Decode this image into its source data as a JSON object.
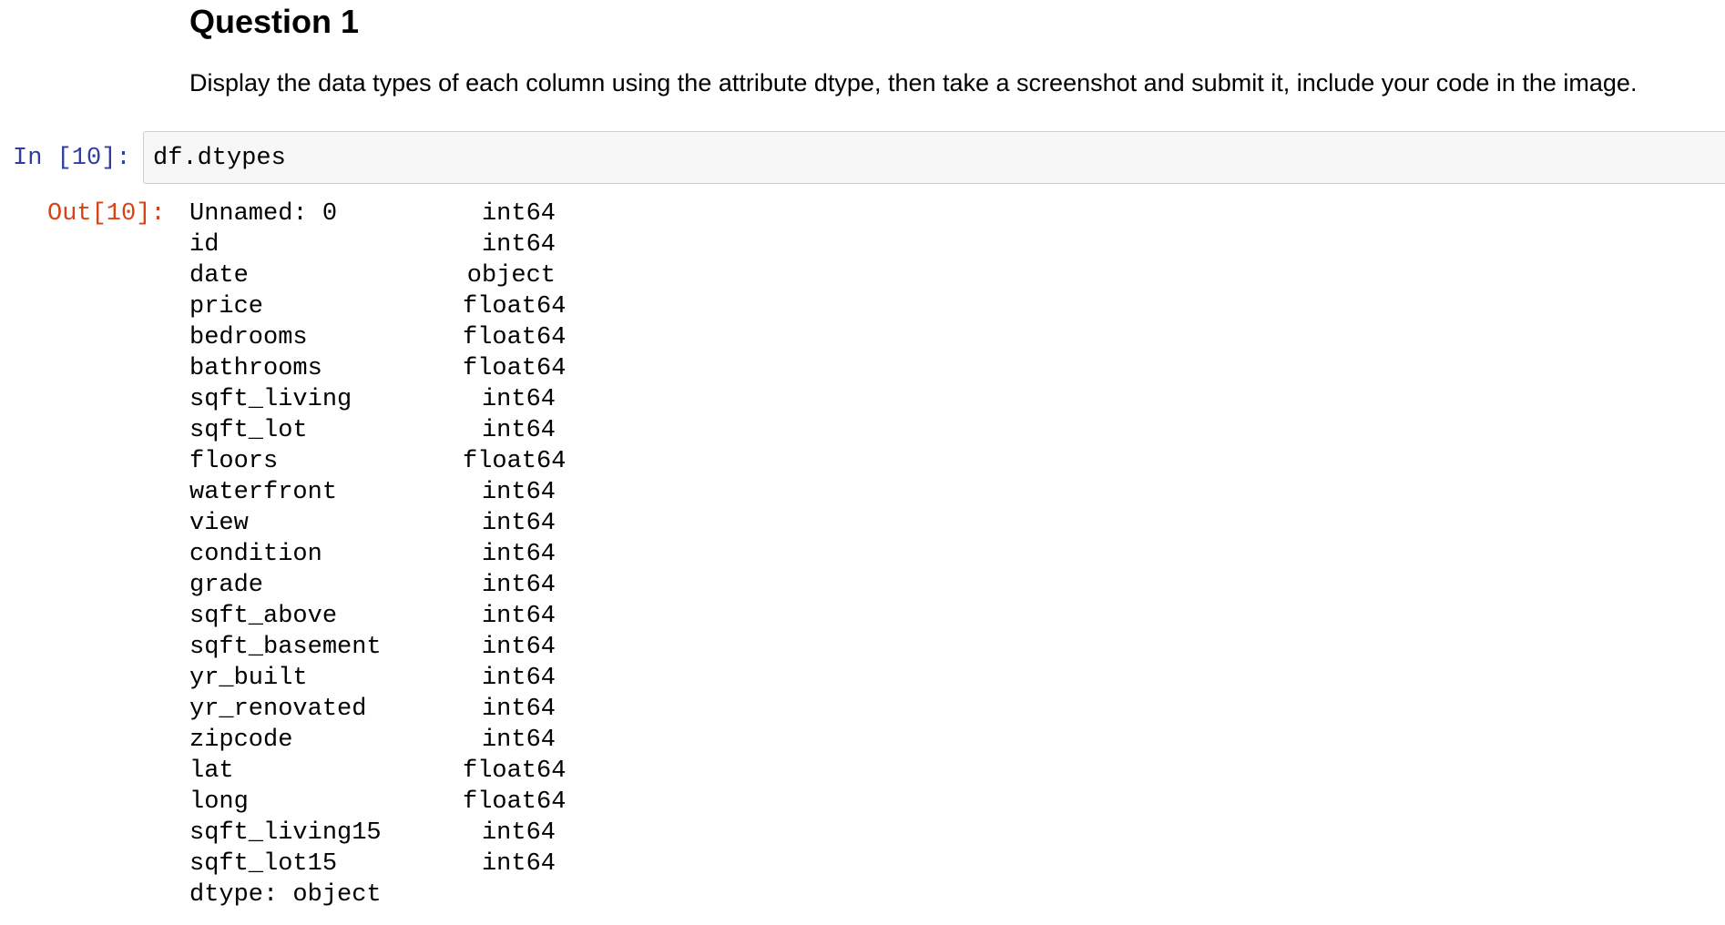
{
  "markdown": {
    "heading": "Question 1",
    "paragraph": "Display the data types of each column using the attribute dtype, then take a screenshot and submit it, include your code in the image."
  },
  "input_cell": {
    "prompt": "In [10]:",
    "code": "df.dtypes"
  },
  "output_cell": {
    "prompt": "Out[10]:",
    "rows": [
      {
        "name": "Unnamed: 0",
        "dtype": "int64"
      },
      {
        "name": "id",
        "dtype": "int64"
      },
      {
        "name": "date",
        "dtype": "object"
      },
      {
        "name": "price",
        "dtype": "float64"
      },
      {
        "name": "bedrooms",
        "dtype": "float64"
      },
      {
        "name": "bathrooms",
        "dtype": "float64"
      },
      {
        "name": "sqft_living",
        "dtype": "int64"
      },
      {
        "name": "sqft_lot",
        "dtype": "int64"
      },
      {
        "name": "floors",
        "dtype": "float64"
      },
      {
        "name": "waterfront",
        "dtype": "int64"
      },
      {
        "name": "view",
        "dtype": "int64"
      },
      {
        "name": "condition",
        "dtype": "int64"
      },
      {
        "name": "grade",
        "dtype": "int64"
      },
      {
        "name": "sqft_above",
        "dtype": "int64"
      },
      {
        "name": "sqft_basement",
        "dtype": "int64"
      },
      {
        "name": "yr_built",
        "dtype": "int64"
      },
      {
        "name": "yr_renovated",
        "dtype": "int64"
      },
      {
        "name": "zipcode",
        "dtype": "int64"
      },
      {
        "name": "lat",
        "dtype": "float64"
      },
      {
        "name": "long",
        "dtype": "float64"
      },
      {
        "name": "sqft_living15",
        "dtype": "int64"
      },
      {
        "name": "sqft_lot15",
        "dtype": "int64"
      }
    ],
    "footer": "dtype: object"
  },
  "colors": {
    "input_prompt": "#303f9f",
    "output_prompt": "#d84315",
    "input_background": "#f7f7f7",
    "input_border": "#cfcfcf"
  }
}
